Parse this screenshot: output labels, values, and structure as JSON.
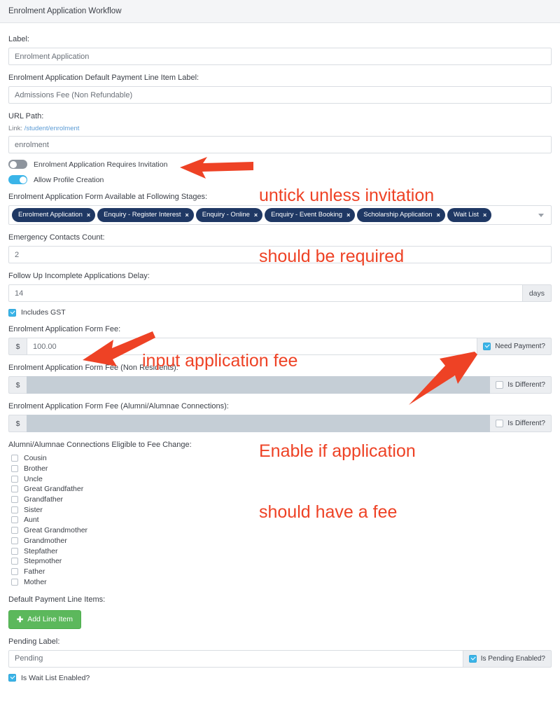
{
  "panel": {
    "title": "Enrolment Application Workflow"
  },
  "fields": {
    "label": {
      "label": "Label:",
      "value": "Enrolment Application"
    },
    "default_payment_line_item_label": {
      "label": "Enrolment Application Default Payment Line Item Label:",
      "value": "Admissions Fee (Non Refundable)"
    },
    "url_path": {
      "label": "URL Path:",
      "link_prefix": "Link:",
      "link_text": "/student/enrolment",
      "value": "enrolment"
    },
    "requires_invitation": {
      "label": "Enrolment Application Requires Invitation",
      "state": "off"
    },
    "allow_profile_creation": {
      "label": "Allow Profile Creation",
      "state": "on"
    },
    "stages": {
      "label": "Enrolment Application Form Available at Following Stages:",
      "tags": [
        "Enrolment Application",
        "Enquiry - Register Interest",
        "Enquiry - Online",
        "Enquiry - Event Booking",
        "Scholarship Application",
        "Wait List"
      ],
      "remove_glyph": "×",
      "caret_icon": "chevron-down-icon"
    },
    "emergency_contacts_count": {
      "label": "Emergency Contacts Count:",
      "value": "2"
    },
    "follow_up_delay": {
      "label": "Follow Up Incomplete Applications Delay:",
      "value": "14",
      "suffix": "days"
    },
    "includes_gst": {
      "label": "Includes GST",
      "checked": true
    },
    "form_fee": {
      "label": "Enrolment Application Form Fee:",
      "currency": "$",
      "value": "100.00",
      "toggle_label": "Need Payment?",
      "toggle_checked": true
    },
    "form_fee_non_residents": {
      "label": "Enrolment Application Form Fee (Non Residents):",
      "currency": "$",
      "value": "",
      "toggle_label": "Is Different?",
      "toggle_checked": false
    },
    "form_fee_alumni": {
      "label": "Enrolment Application Form Fee (Alumni/Alumnae Connections):",
      "currency": "$",
      "value": "",
      "toggle_label": "Is Different?",
      "toggle_checked": false
    },
    "alumni_eligible": {
      "label": "Alumni/Alumnae Connections Eligible to Fee Change:",
      "options": [
        {
          "label": "Cousin",
          "checked": false
        },
        {
          "label": "Brother",
          "checked": false
        },
        {
          "label": "Uncle",
          "checked": false
        },
        {
          "label": "Great Grandfather",
          "checked": false
        },
        {
          "label": "Grandfather",
          "checked": false
        },
        {
          "label": "Sister",
          "checked": false
        },
        {
          "label": "Aunt",
          "checked": false
        },
        {
          "label": "Great Grandmother",
          "checked": false
        },
        {
          "label": "Grandmother",
          "checked": false
        },
        {
          "label": "Stepfather",
          "checked": false
        },
        {
          "label": "Stepmother",
          "checked": false
        },
        {
          "label": "Father",
          "checked": false
        },
        {
          "label": "Mother",
          "checked": false
        }
      ]
    },
    "default_payment_line_items": {
      "label": "Default Payment Line Items:",
      "add_button": "Add Line Item",
      "add_icon": "plus-icon"
    },
    "pending_label": {
      "label": "Pending Label:",
      "value": "Pending",
      "toggle_label": "Is Pending Enabled?",
      "toggle_checked": true
    },
    "wait_list_enabled": {
      "label": "Is Wait List Enabled?",
      "checked": true
    }
  },
  "annotations": [
    {
      "name": "annotation-untick-invitation",
      "line1": "untick unless invitation",
      "line2": "should be required"
    },
    {
      "name": "annotation-input-fee",
      "line1": "input application fee"
    },
    {
      "name": "annotation-enable-fee",
      "line1": "Enable if application",
      "line2": "should have a fee"
    }
  ],
  "colors": {
    "annotation": "#ee4225",
    "tag": "#1f3864",
    "toggle_on": "#3ab4e8",
    "checkbox_checked": "#3ab4e8",
    "button_green": "#5cb85c",
    "disabled_input": "#c5ced6"
  }
}
